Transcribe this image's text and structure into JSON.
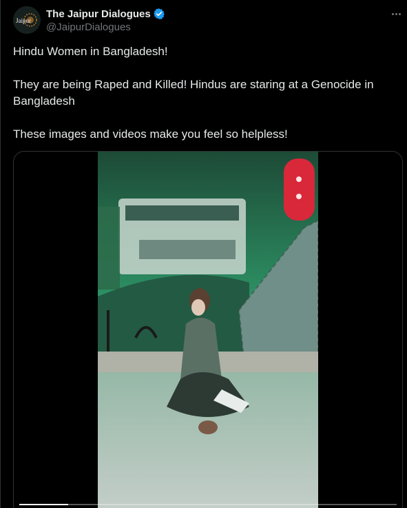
{
  "author": {
    "display_name": "The Jaipur Dialogues",
    "handle": "@JaipurDialogues",
    "avatar_text": "Jaipur",
    "verified": true,
    "avatar_icon": "jaipur-dialogues-logo"
  },
  "tweet": {
    "line1": "Hindu Women in Bangladesh!",
    "line2": "They are being Raped and Killed! Hindus are staring at a Genocide in Bangladesh",
    "line3": "These images and videos make you feel so helpless!"
  },
  "menu": {
    "icon": "more-options-icon"
  },
  "media": {
    "type": "video",
    "progress_fraction": 0.13
  },
  "colors": {
    "background": "#000000",
    "text": "#e7e9ea",
    "secondary_text": "#71767b",
    "verified_blue": "#1d9bf0",
    "border": "#2f3336"
  }
}
